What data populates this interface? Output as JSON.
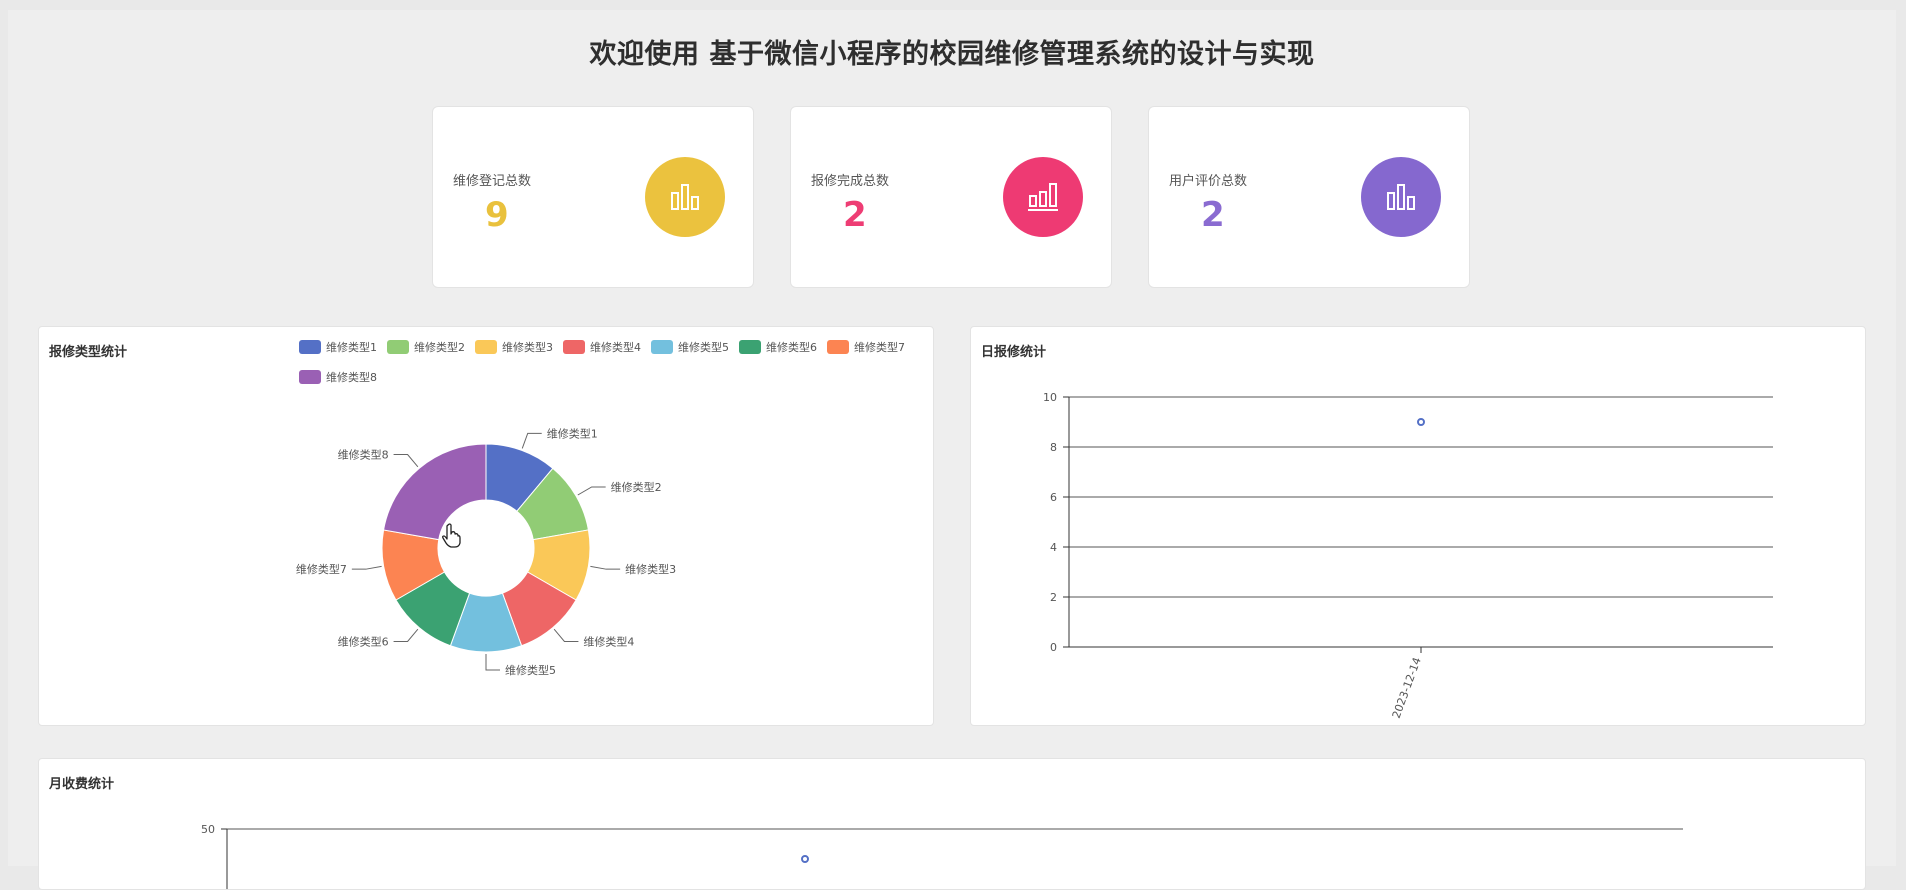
{
  "header": {
    "title": "欢迎使用 基于微信小程序的校园维修管理系统的设计与实现"
  },
  "stats": [
    {
      "label": "维修登记总数",
      "value": "9",
      "color": "#e9c13d",
      "icon": "bar-chart-icon"
    },
    {
      "label": "报修完成总数",
      "value": "2",
      "color": "#ee3d74",
      "icon": "bar-chart-icon"
    },
    {
      "label": "用户评价总数",
      "value": "2",
      "color": "#8a6bd1",
      "icon": "bar-chart-icon"
    }
  ],
  "pie_panel": {
    "title": "报修类型统计"
  },
  "day_panel": {
    "title": "日报修统计"
  },
  "month_panel": {
    "title": "月收费统计"
  },
  "chart_data": [
    {
      "type": "pie",
      "variant": "donut",
      "categories": [
        "维修类型1",
        "维修类型2",
        "维修类型3",
        "维修类型4",
        "维修类型5",
        "维修类型6",
        "维修类型7",
        "维修类型8"
      ],
      "values": [
        1,
        1,
        1,
        1,
        1,
        1,
        1,
        2
      ],
      "colors": [
        "#5470c6",
        "#91cc75",
        "#fac858",
        "#ee6666",
        "#73c0de",
        "#3ba272",
        "#fc8452",
        "#9a60b4"
      ],
      "legend": "top"
    },
    {
      "type": "scatter",
      "x": [
        "2023-12-14"
      ],
      "y": [
        9
      ],
      "ylim": [
        0,
        10
      ],
      "yticks": [
        0,
        2,
        4,
        6,
        8,
        10
      ],
      "grid": true,
      "color": "#5470c6"
    },
    {
      "type": "scatter",
      "ytick_visible": [
        50
      ],
      "y": [
        48
      ],
      "grid": true,
      "color": "#5470c6"
    }
  ]
}
